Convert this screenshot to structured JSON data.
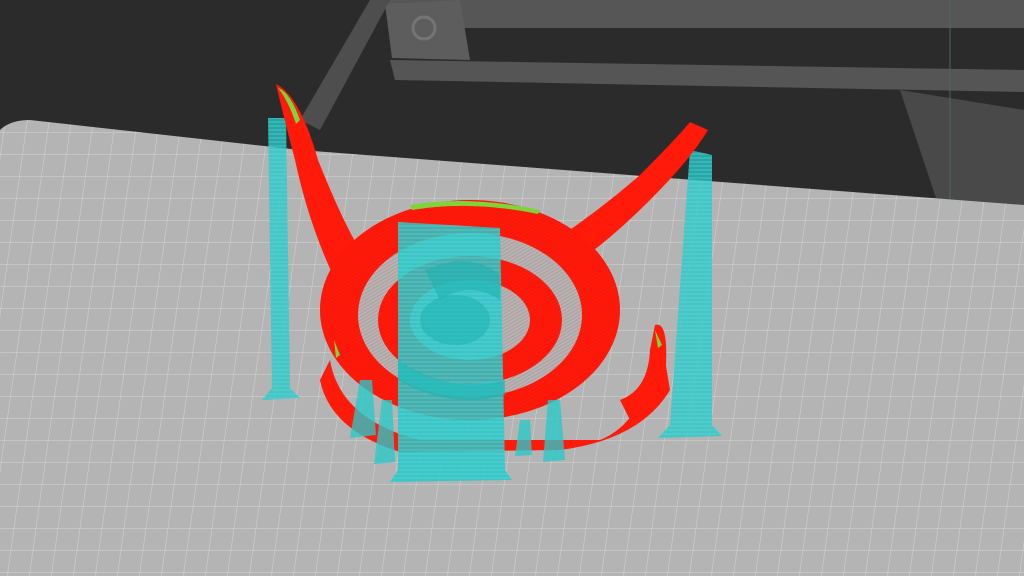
{
  "app": {
    "view": "slicer-preview-3d"
  },
  "colors": {
    "background": "#2b2b2b",
    "printer_frame": "#9a9a9a",
    "bed": "#b4b4b4",
    "bed_grid": "#d2d2d2",
    "model_perimeter": "#ff1a0a",
    "model_highlight": "#7fd43a",
    "support_material": "#28c8c8"
  },
  "icons": {
    "bed": "build-plate",
    "frame": "printer-frame",
    "model": "sliced-model",
    "supports": "support-pillars"
  }
}
